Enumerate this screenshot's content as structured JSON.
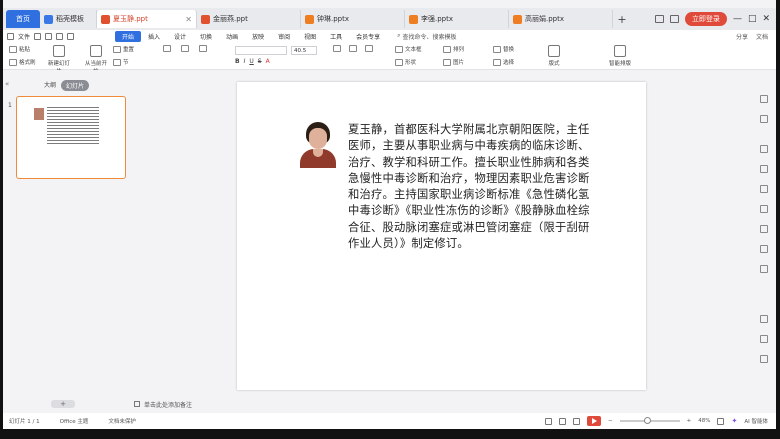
{
  "tabs": {
    "home": "首页",
    "files": [
      {
        "label": "稻壳模板",
        "icon": "blue",
        "active": false
      },
      {
        "label": "夏玉静.ppt",
        "icon": "red",
        "active": true
      },
      {
        "label": "金丽燕.ppt",
        "icon": "red",
        "active": false
      },
      {
        "label": "钟琳.pptx",
        "icon": "orange",
        "active": false
      },
      {
        "label": "李强.pptx",
        "icon": "orange",
        "active": false
      },
      {
        "label": "高丽娟.pptx",
        "icon": "orange",
        "active": false
      }
    ],
    "login": "立即登录"
  },
  "menu": {
    "file": "文件",
    "items": [
      "开始",
      "插入",
      "设计",
      "切换",
      "动画",
      "放映",
      "审阅",
      "视图",
      "工具",
      "会员专享"
    ],
    "search": "查找命令、搜索模板",
    "right": [
      "分享",
      "文档"
    ]
  },
  "toolbar": {
    "paste": "粘贴",
    "format_painter": "格式刷",
    "new_slide": "新建幻灯片",
    "reset": "重置",
    "section": "节",
    "from_current": "从当前开始",
    "font": "",
    "size": "40.5",
    "text_box": "文本框",
    "shape": "形状",
    "arrange": "排列",
    "replace": "替换",
    "picture": "图片",
    "select": "选择",
    "layout": "版式",
    "smart": "智能排版"
  },
  "panel": {
    "outline_tab": "大纲",
    "slides_tab": "幻灯片",
    "slide_number": "1"
  },
  "slide": {
    "text": "夏玉静，首都医科大学附属北京朝阳医院，主任医师，主要从事职业病与中毒疾病的临床诊断、治疗、教学和科研工作。擅长职业性肺病和各类急慢性中毒诊断和治疗，物理因素职业危害诊断和治疗。主持国家职业病诊断标准《急性磷化氢中毒诊断》《职业性冻伤的诊断》《股静脉血栓综合征、股动脉闭塞症或淋巴管闭塞症（限于刮研作业人员）》制定修订。"
  },
  "notes": {
    "placeholder": "单击此处添加备注"
  },
  "status": {
    "slide_count": "幻灯片 1 / 1",
    "theme": "Office 主题",
    "doc_protect": "文档未保护",
    "zoom": "48%",
    "ai": "AI 智能体"
  }
}
